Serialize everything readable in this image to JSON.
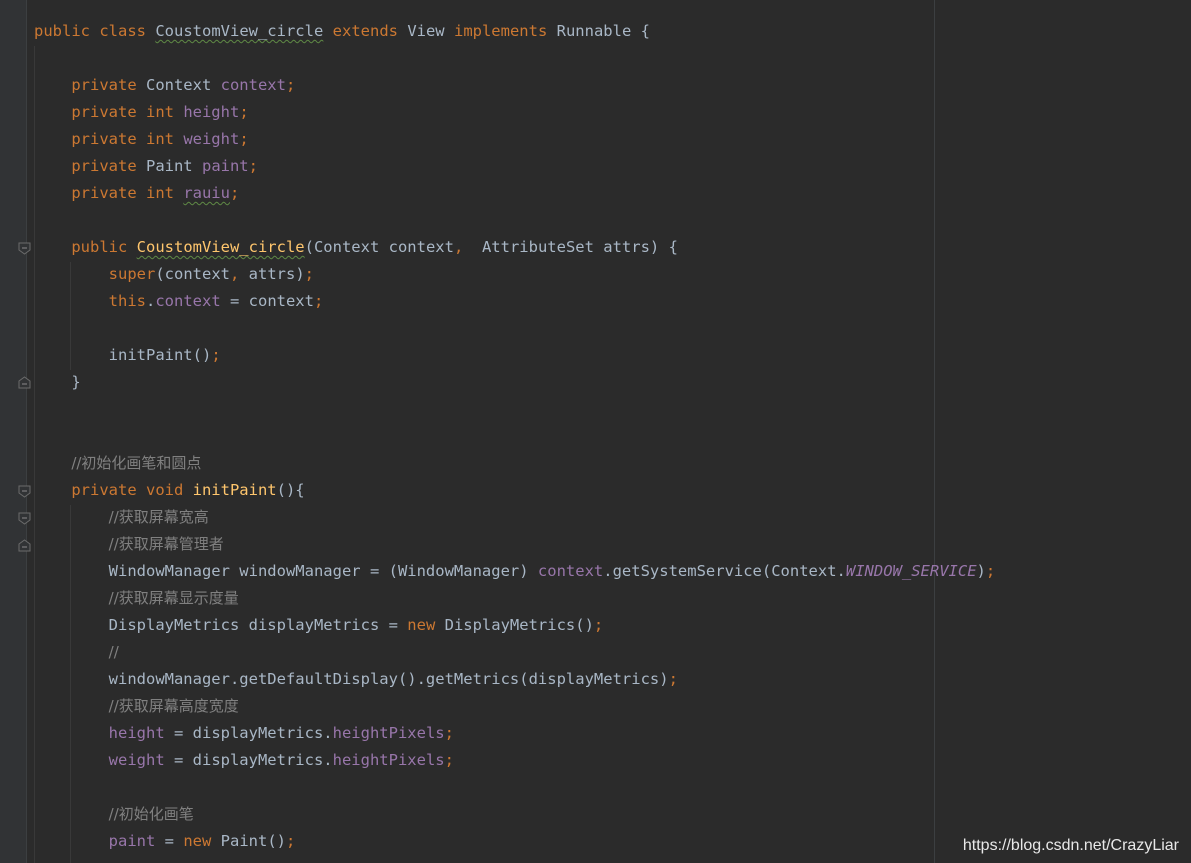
{
  "editor": {
    "theme": "darcula",
    "colors": {
      "background": "#2b2b2b",
      "keyword": "#cc7832",
      "field": "#9876aa",
      "method": "#ffc66d",
      "comment": "#808080",
      "text": "#a9b7c6"
    },
    "lines": [
      {
        "tokens": [
          {
            "t": "public class ",
            "c": "kw"
          },
          {
            "t": "CoustomView_circle",
            "c": "p typo"
          },
          {
            "t": " ",
            "c": "p"
          },
          {
            "t": "extends ",
            "c": "kw"
          },
          {
            "t": "View ",
            "c": "p"
          },
          {
            "t": "implements ",
            "c": "kw"
          },
          {
            "t": "Runnable {",
            "c": "p"
          }
        ]
      },
      {
        "tokens": []
      },
      {
        "tokens": [
          {
            "t": "    private ",
            "c": "kw"
          },
          {
            "t": "Context ",
            "c": "p"
          },
          {
            "t": "context",
            "c": "fld"
          },
          {
            "t": ";",
            "c": "semi"
          }
        ]
      },
      {
        "tokens": [
          {
            "t": "    private int ",
            "c": "kw"
          },
          {
            "t": "height",
            "c": "fld"
          },
          {
            "t": ";",
            "c": "semi"
          }
        ]
      },
      {
        "tokens": [
          {
            "t": "    private int ",
            "c": "kw"
          },
          {
            "t": "weight",
            "c": "fld"
          },
          {
            "t": ";",
            "c": "semi"
          }
        ]
      },
      {
        "tokens": [
          {
            "t": "    private ",
            "c": "kw"
          },
          {
            "t": "Paint ",
            "c": "p"
          },
          {
            "t": "paint",
            "c": "fld"
          },
          {
            "t": ";",
            "c": "semi"
          }
        ]
      },
      {
        "tokens": [
          {
            "t": "    private int ",
            "c": "kw"
          },
          {
            "t": "rauiu",
            "c": "fld typo"
          },
          {
            "t": ";",
            "c": "semi"
          }
        ]
      },
      {
        "tokens": []
      },
      {
        "tokens": [
          {
            "t": "    public ",
            "c": "kw"
          },
          {
            "t": "CoustomView_circle",
            "c": "fn typo"
          },
          {
            "t": "(Context context",
            "c": "p"
          },
          {
            "t": ",  ",
            "c": "semi"
          },
          {
            "t": "AttributeSet attrs) {",
            "c": "p"
          }
        ]
      },
      {
        "tokens": [
          {
            "t": "        super",
            "c": "kw"
          },
          {
            "t": "(context",
            "c": "p"
          },
          {
            "t": ", ",
            "c": "semi"
          },
          {
            "t": "attrs)",
            "c": "p"
          },
          {
            "t": ";",
            "c": "semi"
          }
        ]
      },
      {
        "tokens": [
          {
            "t": "        this",
            "c": "kw"
          },
          {
            "t": ".",
            "c": "p"
          },
          {
            "t": "context",
            "c": "fld"
          },
          {
            "t": " = context",
            "c": "p"
          },
          {
            "t": ";",
            "c": "semi"
          }
        ]
      },
      {
        "tokens": []
      },
      {
        "tokens": [
          {
            "t": "        initPaint()",
            "c": "p"
          },
          {
            "t": ";",
            "c": "semi"
          }
        ]
      },
      {
        "tokens": [
          {
            "t": "    }",
            "c": "p"
          }
        ]
      },
      {
        "tokens": []
      },
      {
        "tokens": []
      },
      {
        "tokens": [
          {
            "t": "    ",
            "c": "p"
          },
          {
            "t": "//初始化画笔和圆点",
            "c": "cm"
          }
        ]
      },
      {
        "tokens": [
          {
            "t": "    private void ",
            "c": "kw"
          },
          {
            "t": "initPaint",
            "c": "fn"
          },
          {
            "t": "(){",
            "c": "p"
          }
        ]
      },
      {
        "tokens": [
          {
            "t": "        ",
            "c": "p"
          },
          {
            "t": "//获取屏幕宽高",
            "c": "cm"
          }
        ]
      },
      {
        "tokens": [
          {
            "t": "        ",
            "c": "p"
          },
          {
            "t": "//获取屏幕管理者",
            "c": "cm"
          }
        ]
      },
      {
        "tokens": [
          {
            "t": "        WindowManager windowManager = (WindowManager) ",
            "c": "p"
          },
          {
            "t": "context",
            "c": "fld"
          },
          {
            "t": ".getSystemService(Context.",
            "c": "p"
          },
          {
            "t": "WINDOW_SERVICE",
            "c": "const"
          },
          {
            "t": ")",
            "c": "p"
          },
          {
            "t": ";",
            "c": "semi"
          }
        ]
      },
      {
        "tokens": [
          {
            "t": "        ",
            "c": "p"
          },
          {
            "t": "//获取屏幕显示度量",
            "c": "cm"
          }
        ]
      },
      {
        "tokens": [
          {
            "t": "        DisplayMetrics displayMetrics = ",
            "c": "p"
          },
          {
            "t": "new ",
            "c": "kw"
          },
          {
            "t": "DisplayMetrics()",
            "c": "p"
          },
          {
            "t": ";",
            "c": "semi"
          }
        ]
      },
      {
        "tokens": [
          {
            "t": "        ",
            "c": "p"
          },
          {
            "t": "//",
            "c": "cm"
          }
        ]
      },
      {
        "tokens": [
          {
            "t": "        windowManager.getDefaultDisplay().getMetrics(displayMetrics)",
            "c": "p"
          },
          {
            "t": ";",
            "c": "semi"
          }
        ]
      },
      {
        "tokens": [
          {
            "t": "        ",
            "c": "p"
          },
          {
            "t": "//获取屏幕高度宽度",
            "c": "cm"
          }
        ]
      },
      {
        "tokens": [
          {
            "t": "        ",
            "c": "p"
          },
          {
            "t": "height",
            "c": "fld"
          },
          {
            "t": " = displayMetrics.",
            "c": "p"
          },
          {
            "t": "heightPixels",
            "c": "fld"
          },
          {
            "t": ";",
            "c": "semi"
          }
        ]
      },
      {
        "tokens": [
          {
            "t": "        ",
            "c": "p"
          },
          {
            "t": "weight",
            "c": "fld"
          },
          {
            "t": " = displayMetrics.",
            "c": "p"
          },
          {
            "t": "heightPixels",
            "c": "fld"
          },
          {
            "t": ";",
            "c": "semi"
          }
        ]
      },
      {
        "tokens": []
      },
      {
        "tokens": [
          {
            "t": "        ",
            "c": "p"
          },
          {
            "t": "//初始化画笔",
            "c": "cm"
          }
        ]
      },
      {
        "tokens": [
          {
            "t": "        paint",
            "c": "fld"
          },
          {
            "t": " = ",
            "c": "p"
          },
          {
            "t": "new ",
            "c": "kw"
          },
          {
            "t": "Paint()",
            "c": "p"
          },
          {
            "t": ";",
            "c": "semi"
          }
        ]
      }
    ]
  },
  "watermark": "https://blog.csdn.net/CrazyLiar"
}
